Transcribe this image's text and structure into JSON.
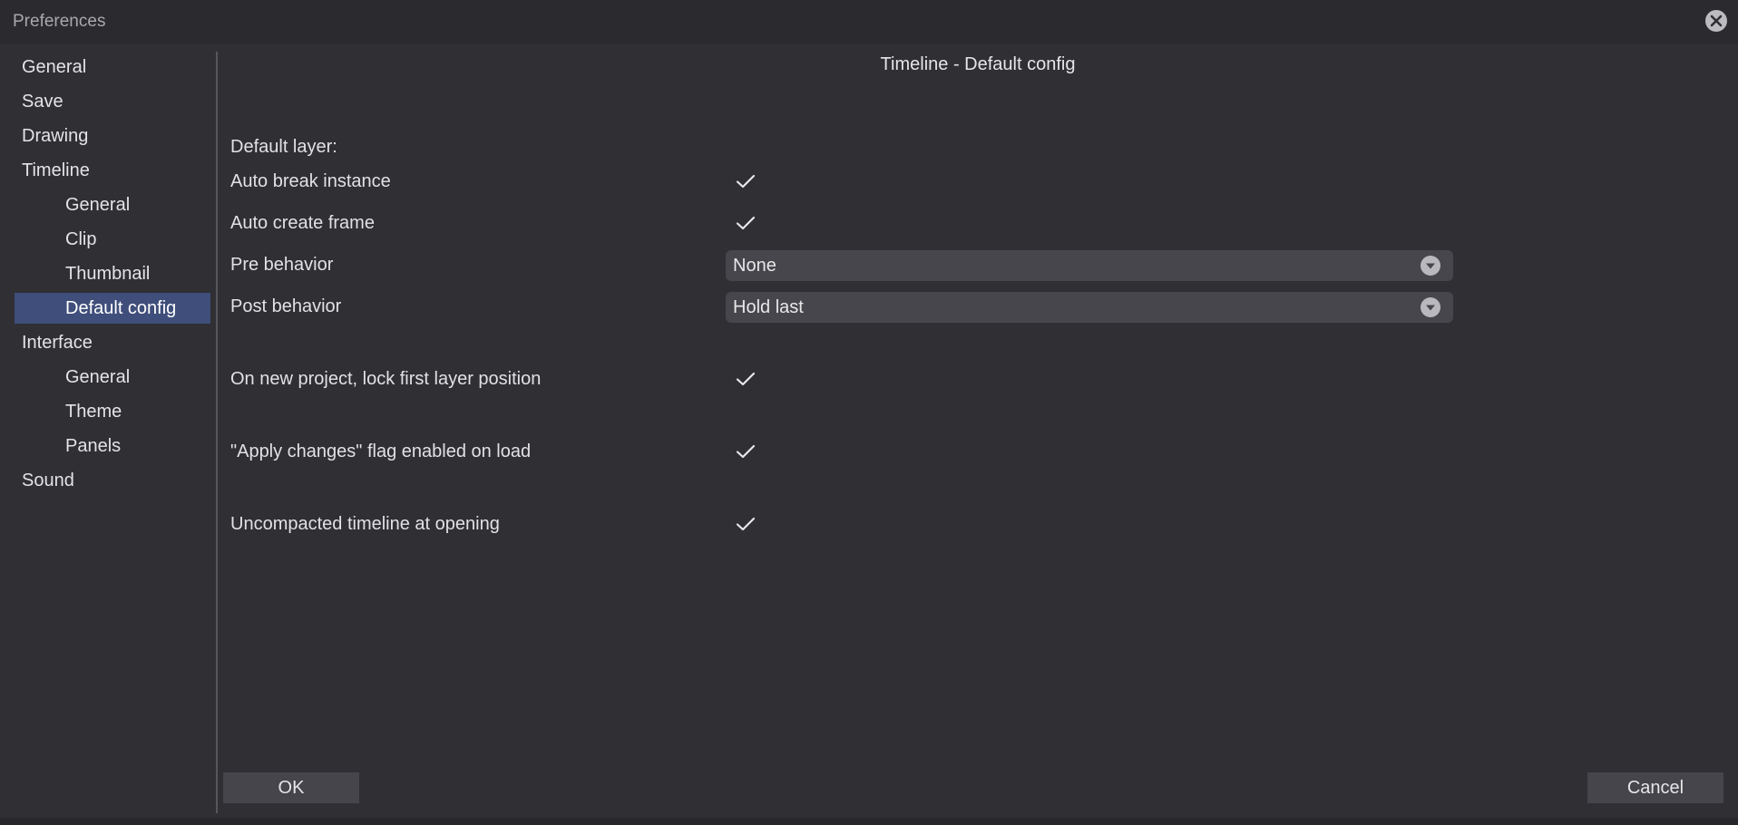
{
  "window": {
    "title": "Preferences"
  },
  "sidebar": {
    "items": [
      {
        "label": "General"
      },
      {
        "label": "Save"
      },
      {
        "label": "Drawing"
      },
      {
        "label": "Timeline"
      },
      {
        "label": "General"
      },
      {
        "label": "Clip"
      },
      {
        "label": "Thumbnail"
      },
      {
        "label": "Default config",
        "selected": true
      },
      {
        "label": "Interface"
      },
      {
        "label": "General"
      },
      {
        "label": "Theme"
      },
      {
        "label": "Panels"
      },
      {
        "label": "Sound"
      }
    ]
  },
  "panel": {
    "title": "Timeline - Default config",
    "section_label": "Default layer:",
    "auto_break_instance": {
      "label": "Auto break instance",
      "checked": true
    },
    "auto_create_frame": {
      "label": "Auto create frame",
      "checked": true
    },
    "pre_behavior": {
      "label": "Pre behavior",
      "value": "None"
    },
    "post_behavior": {
      "label": "Post behavior",
      "value": "Hold last"
    },
    "lock_first_layer": {
      "label": "On new project, lock first layer position",
      "checked": true
    },
    "apply_changes_flag": {
      "label": "\"Apply changes\" flag enabled on load",
      "checked": true
    },
    "uncompacted_timeline": {
      "label": "Uncompacted timeline at opening",
      "checked": true
    }
  },
  "buttons": {
    "ok": "OK",
    "cancel": "Cancel"
  },
  "colors": {
    "background": "#2f2f34",
    "selection": "#3f4e7a",
    "control": "#46464c"
  }
}
